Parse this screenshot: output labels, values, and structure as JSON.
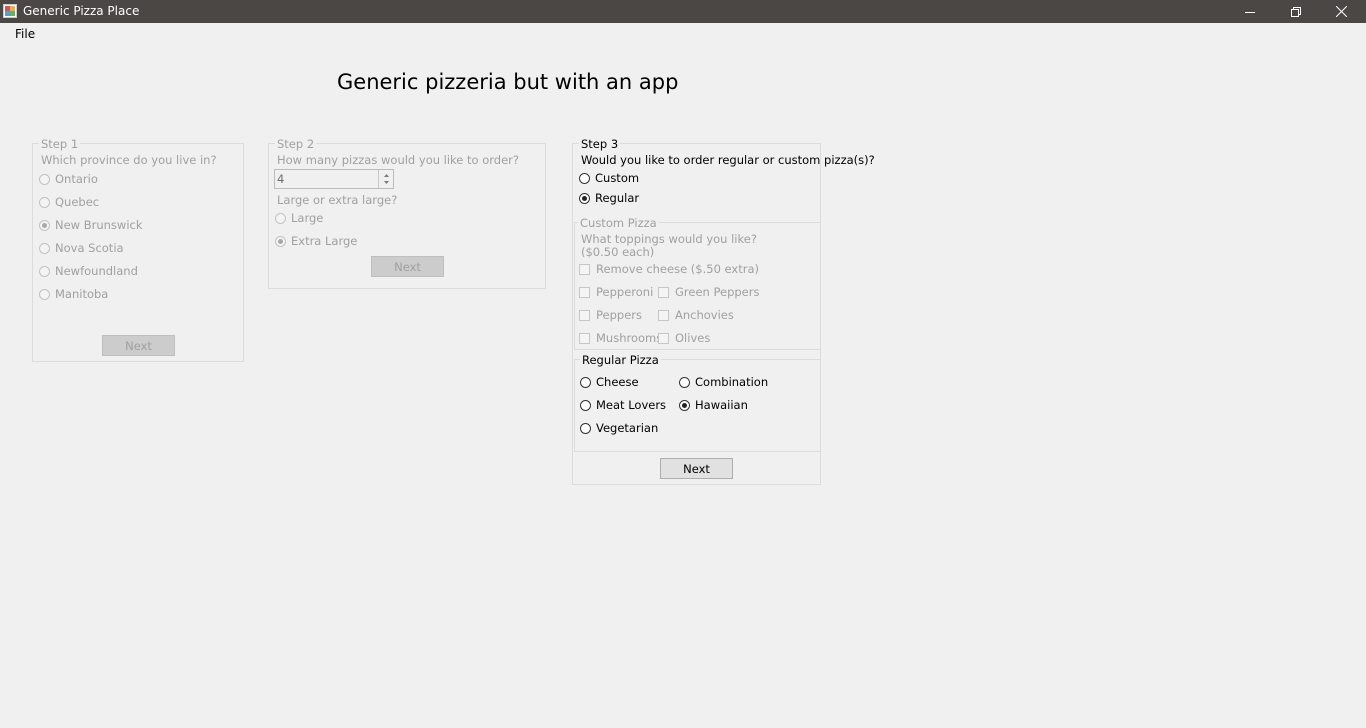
{
  "window": {
    "title": "Generic Pizza Place"
  },
  "menu": {
    "file": "File"
  },
  "heading": "Generic pizzeria but with an app",
  "step1": {
    "legend": "Step 1",
    "question": "Which province do you live in?",
    "options": [
      "Ontario",
      "Quebec",
      "New Brunswick",
      "Nova Scotia",
      "Newfoundland",
      "Manitoba"
    ],
    "selected": "New Brunswick",
    "next": "Next"
  },
  "step2": {
    "legend": "Step 2",
    "question": "How many pizzas would you like to order?",
    "quantity": "4",
    "size_question": "Large or extra large?",
    "sizes": [
      "Large",
      "Extra Large"
    ],
    "selected": "Extra Large",
    "next": "Next"
  },
  "step3": {
    "legend": "Step 3",
    "question": "Would you like to order regular or custom pizza(s)?",
    "types": [
      "Custom",
      "Regular"
    ],
    "selected": "Regular",
    "custom": {
      "legend": "Custom Pizza",
      "question_line1": "What toppings would you like?",
      "question_line2": "($0.50 each)",
      "remove_cheese": "Remove cheese ($.50 extra)",
      "toppings": [
        "Pepperoni",
        "Green Peppers",
        "Peppers",
        "Anchovies",
        "Mushrooms",
        "Olives"
      ]
    },
    "regular": {
      "legend": "Regular Pizza",
      "options": [
        "Cheese",
        "Combination",
        "Meat Lovers",
        "Hawaiian",
        "Vegetarian"
      ],
      "selected": "Hawaiian"
    },
    "next": "Next"
  }
}
